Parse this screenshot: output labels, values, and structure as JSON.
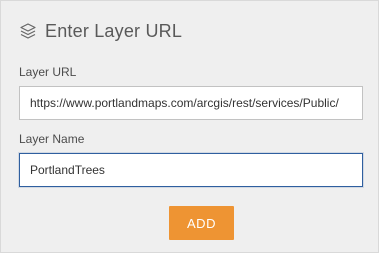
{
  "dialog": {
    "title": "Enter Layer URL",
    "title_icon": "layers-icon"
  },
  "fields": {
    "url": {
      "label": "Layer URL",
      "value": "https://www.portlandmaps.com/arcgis/rest/services/Public/"
    },
    "name": {
      "label": "Layer Name",
      "value": "PortlandTrees"
    }
  },
  "actions": {
    "add_label": "ADD"
  },
  "colors": {
    "panel_background": "#efefef",
    "accent_button": "#ee9433",
    "focused_border": "#2f5f9f"
  }
}
